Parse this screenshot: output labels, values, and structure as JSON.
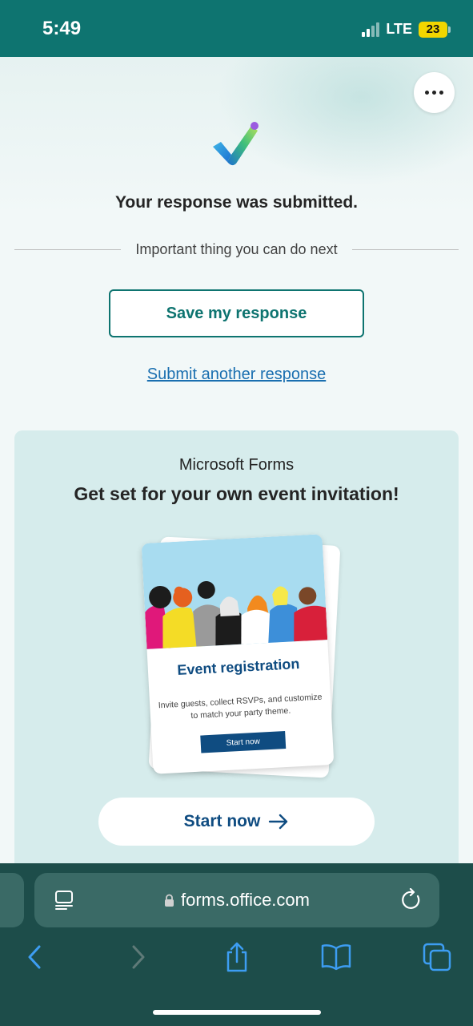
{
  "status_bar": {
    "time": "5:49",
    "network": "LTE",
    "battery": "23"
  },
  "page": {
    "more_label": "More options",
    "title": "Your response was submitted.",
    "next_steps_label": "Important thing you can do next",
    "save_button": "Save my response",
    "submit_another_link": "Submit another response"
  },
  "promo": {
    "brand": "Microsoft Forms",
    "heading": "Get set for your own event invitation!",
    "card": {
      "title": "Event registration",
      "description": "Invite guests, collect RSVPs, and customize to match your party theme.",
      "button": "Start now"
    },
    "start_button": "Start now",
    "start_icon": "arrow-right-icon"
  },
  "browser": {
    "url": "forms.office.com",
    "icons": [
      "reader-icon",
      "lock-icon",
      "reload-icon",
      "back-icon",
      "forward-icon",
      "share-icon",
      "bookmarks-icon",
      "tabs-icon"
    ]
  },
  "colors": {
    "accent": "#0e7470",
    "link": "#1a6fb0",
    "brand_blue": "#0f4c81"
  }
}
